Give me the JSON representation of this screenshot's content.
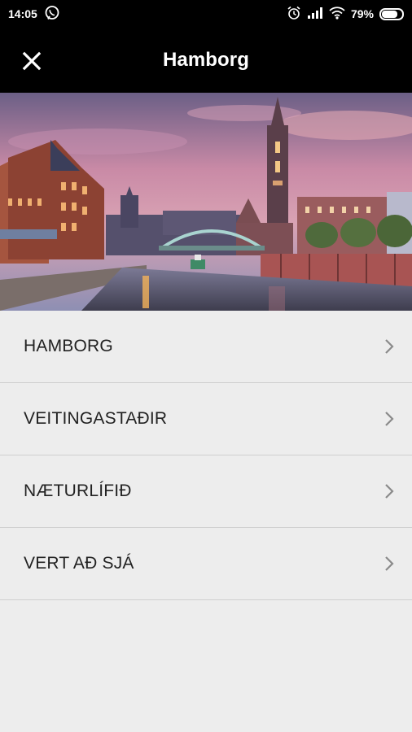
{
  "status": {
    "time": "14:05",
    "battery": "79%",
    "battery_level": 0.79,
    "icons": [
      "viber-icon",
      "alarm-icon",
      "signal-icon",
      "wifi-icon",
      "battery-icon"
    ]
  },
  "appbar": {
    "title": "Hamborg",
    "close_icon": "close-icon"
  },
  "hero": {
    "image": "hamburg-speicherstadt-dusk-photo"
  },
  "menu": {
    "items": [
      {
        "label": "HAMBORG",
        "icon": "chevron-right-icon"
      },
      {
        "label": "VEITINGASTAÐIR",
        "icon": "chevron-right-icon"
      },
      {
        "label": "NÆTURLÍFIÐ",
        "icon": "chevron-right-icon"
      },
      {
        "label": "VERT AÐ SJÁ",
        "icon": "chevron-right-icon"
      }
    ]
  },
  "colors": {
    "bar": "#000000",
    "background": "#ededed",
    "divider": "#cfcfcf",
    "text": "#222222",
    "chevron": "#8a8a8a"
  }
}
